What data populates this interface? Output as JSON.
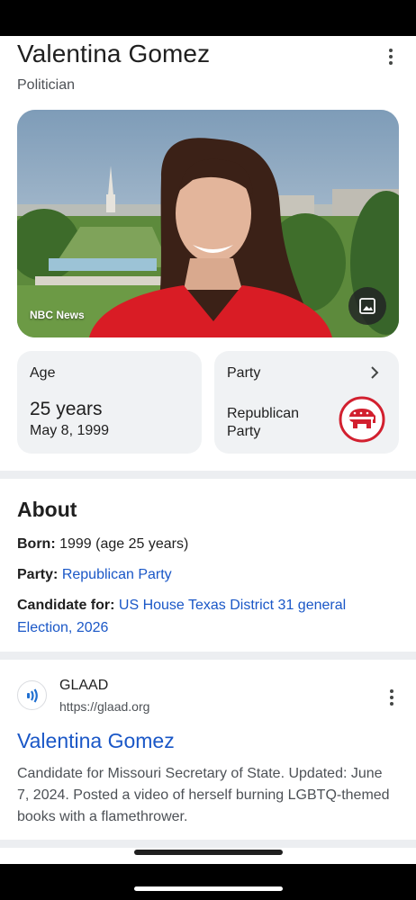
{
  "header": {
    "title": "Valentina Gomez",
    "subtitle": "Politician"
  },
  "hero": {
    "credit": "NBC News"
  },
  "cards": {
    "age": {
      "label": "Age",
      "value": "25 years",
      "date": "May 8, 1999"
    },
    "party": {
      "label": "Party",
      "value": "Republican Party"
    }
  },
  "about": {
    "heading": "About",
    "born_label": "Born:",
    "born_value": "1999 (age 25 years)",
    "party_label": "Party:",
    "party_value": "Republican Party",
    "candidate_label": "Candidate for:",
    "candidate_value": "US House Texas District 31 general Election, 2026"
  },
  "result": {
    "source_name": "GLAAD",
    "source_url": "https://glaad.org",
    "title": "Valentina Gomez",
    "snippet": "Candidate for Missouri Secretary of State. Updated: June 7, 2024. Posted a video of herself burning LGBTQ-themed books with a flamethrower."
  },
  "colors": {
    "link": "#1a57c7",
    "card_bg": "#f0f2f4",
    "gop_red": "#d2202f",
    "divider": "#eceef1"
  },
  "icons": {
    "more": "more-vert-icon",
    "image": "image-icon",
    "chevron": "chevron-right-icon",
    "party_logo": "gop-elephant-icon",
    "source": "glaad-logo-icon"
  }
}
